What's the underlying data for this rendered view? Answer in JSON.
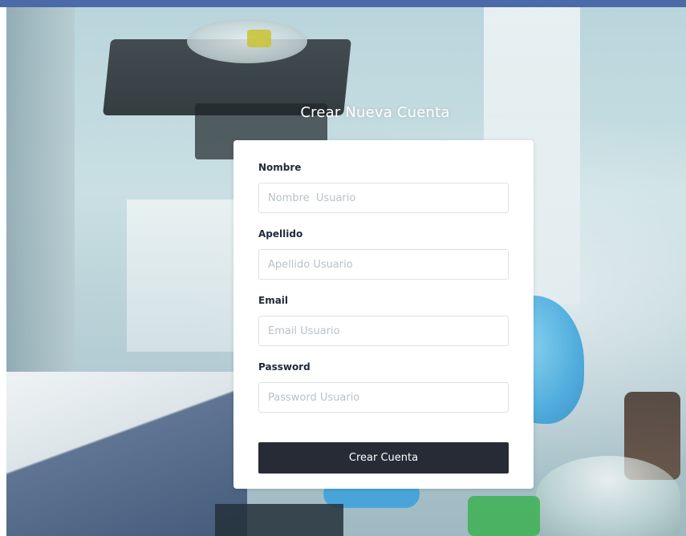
{
  "page": {
    "title": "Crear Nueva Cuenta",
    "accent_color": "#4a6aa8",
    "button_color": "#262b35"
  },
  "form": {
    "fields": [
      {
        "label": "Nombre",
        "placeholder": "Nombre  Usuario",
        "value": ""
      },
      {
        "label": "Apellido",
        "placeholder": "Apellido Usuario",
        "value": ""
      },
      {
        "label": "Email",
        "placeholder": "Email Usuario",
        "value": ""
      },
      {
        "label": "Password",
        "placeholder": "Password Usuario",
        "value": ""
      }
    ],
    "submit_label": "Crear Cuenta"
  }
}
